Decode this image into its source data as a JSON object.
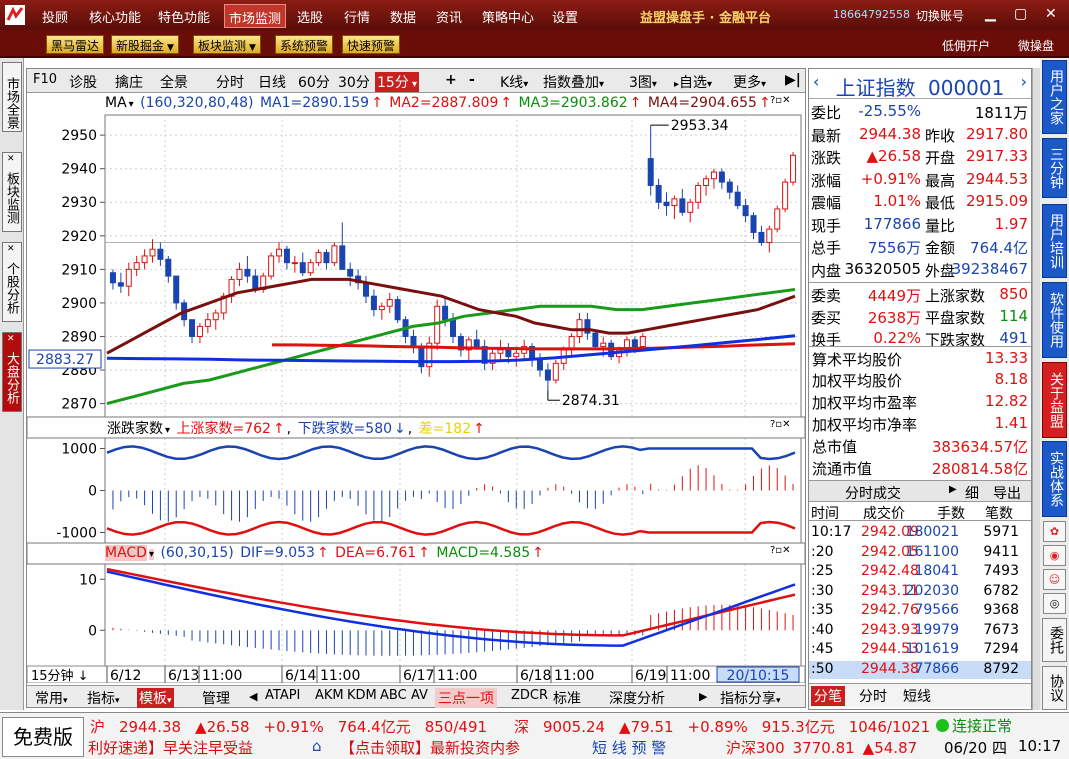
{
  "menubar": {
    "items": [
      "投顾",
      "核心功能",
      "特色功能",
      "市场监测",
      "选股",
      "行情",
      "数据",
      "资讯",
      "策略中心",
      "设置"
    ],
    "active_index": 3,
    "brand": "益盟操盘手 · 金融平台",
    "phone": "18664792558",
    "switch_account": "切换账号"
  },
  "toolbar": {
    "buttons": [
      "黑马雷达",
      "新股掘金",
      "板块监测",
      "系统预警",
      "快速预警"
    ],
    "right": [
      "低佣开户",
      "微操盘"
    ]
  },
  "left_tabs": [
    "市场全景",
    "板块监测",
    "个股分析",
    "大盘分析"
  ],
  "chart_toolbar": {
    "items": [
      "F10",
      "诊股",
      "擒庄",
      "全景",
      "分时",
      "日线",
      "60分",
      "30分",
      "15分",
      "+",
      "-",
      "K线",
      "指数叠加",
      "3图",
      "自选",
      "更多"
    ]
  },
  "ma_indicator": {
    "name": "MA",
    "params": "(160,320,80,48)",
    "ma1": "MA1=2890.159",
    "ma2": "MA2=2887.809",
    "ma3": "MA3=2903.862",
    "ma4": "MA4=2904.655"
  },
  "price_axis": {
    "ticks": [
      "2950",
      "2940",
      "2930",
      "2920",
      "2910",
      "2900",
      "2890",
      "2880",
      "2870"
    ],
    "cursor_price": "2883.27",
    "high_label": "2953.34",
    "low_label": "2874.31"
  },
  "breadth_indicator": {
    "name": "涨跌家数",
    "up": "上涨家数=762",
    "down": "下跌家数=580",
    "diff": "差=182",
    "ticks": [
      "1000",
      "0",
      "-1000"
    ]
  },
  "macd_indicator": {
    "name": "MACD",
    "params": "(60,30,15)",
    "dif": "DIF=9.053",
    "dea": "DEA=6.761",
    "macd": "MACD=4.585",
    "ticks": [
      "10",
      "0"
    ]
  },
  "time_axis": {
    "period": "15分钟",
    "labels": [
      "6/12",
      "6/13",
      "11:00",
      "6/14",
      "11:00",
      "6/17",
      "11:00",
      "6/18",
      "11:00",
      "6/19",
      "11:00"
    ],
    "cursor": "20/10:15"
  },
  "bottom_tabs": [
    "常用",
    "指标",
    "模板",
    "管理",
    "ATAPI",
    "AKM",
    "KDM",
    "ABC",
    "AV",
    "三点一项",
    "ZDCR",
    "标准",
    "深度分析",
    "指标分享"
  ],
  "quote": {
    "title": "上证指数",
    "code": "000001",
    "rows": [
      [
        "委比",
        "-25.55%",
        "",
        "1811万"
      ],
      [
        "最新",
        "2944.38",
        "昨收",
        "2917.80"
      ],
      [
        "涨跌",
        "▲26.58",
        "开盘",
        "2917.33"
      ],
      [
        "涨幅",
        "+0.91%",
        "最高",
        "2944.53"
      ],
      [
        "震幅",
        "1.01%",
        "最低",
        "2915.09"
      ],
      [
        "现手",
        "177866",
        "量比",
        "1.97"
      ],
      [
        "总手",
        "7556万",
        "金额",
        "764.4亿"
      ],
      [
        "内盘",
        "36320505",
        "外盘",
        "39238467"
      ],
      [
        "委卖",
        "4449万",
        "上涨家数",
        "850"
      ],
      [
        "委买",
        "2638万",
        "平盘家数",
        "114"
      ],
      [
        "换手",
        "0.22%",
        "下跌家数",
        "491"
      ]
    ],
    "stats": [
      [
        "算术平均股价",
        "13.33"
      ],
      [
        "加权平均股价",
        "8.18"
      ],
      [
        "加权平均市盈率",
        "12.82"
      ],
      [
        "加权平均市净率",
        "1.41"
      ],
      [
        "总市值",
        "383634.57亿"
      ],
      [
        "流通市值",
        "280814.58亿"
      ]
    ],
    "tick_header": [
      "分时成交",
      "细",
      "导出"
    ],
    "tick_cols": [
      "时间",
      "成交价",
      "手数",
      "笔数"
    ],
    "ticks": [
      [
        "10:17",
        "2942.09",
        "180021",
        "5971"
      ],
      [
        ":20",
        "2942.05",
        "161100",
        "9411"
      ],
      [
        ":25",
        "2942.48",
        "18041",
        "7493"
      ],
      [
        ":30",
        "2943.11",
        "202030",
        "6782"
      ],
      [
        ":35",
        "2942.76",
        "79566",
        "9368"
      ],
      [
        ":40",
        "2943.93",
        "19979",
        "7673"
      ],
      [
        ":45",
        "2944.53",
        "101619",
        "7294"
      ],
      [
        ":50",
        "2944.38",
        "77866",
        "8792"
      ]
    ],
    "bottom_tabs": [
      "分笔",
      "分时",
      "短线"
    ]
  },
  "right_tabs": [
    "用户之家",
    "三分钟",
    "用户培训",
    "软件使用",
    "关于益盟",
    "实战体系"
  ],
  "right_tabs2": [
    "委托",
    "协议"
  ],
  "status": {
    "free": "免费版",
    "sh": [
      "沪",
      "2944.38",
      "▲26.58",
      "+0.91%",
      "764.4亿元",
      "850/491"
    ],
    "sz": [
      "深",
      "9005.24",
      "▲79.51",
      "+0.89%",
      "915.3亿元",
      "1046/1021"
    ],
    "conn": "连接正常",
    "news": "利好速递】早关注早受益",
    "promo": "【点击领取】最新投资内参",
    "warn": "短 线 预 警",
    "hs300": [
      "沪深300",
      "3770.81",
      "▲54.87"
    ],
    "date": "06/20 四",
    "time": "10:17"
  },
  "chart_data": {
    "type": "candlestick",
    "ylim": [
      2866,
      2956
    ],
    "candles": [
      [
        2909,
        2910,
        2904,
        2906
      ],
      [
        2906,
        2909,
        2903,
        2905
      ],
      [
        2905,
        2912,
        2902,
        2910
      ],
      [
        2910,
        2914,
        2908,
        2912
      ],
      [
        2912,
        2916,
        2910,
        2914
      ],
      [
        2914,
        2919,
        2912,
        2916
      ],
      [
        2916,
        2918,
        2911,
        2913
      ],
      [
        2913,
        2914,
        2906,
        2908
      ],
      [
        2908,
        2908,
        2898,
        2900
      ],
      [
        2900,
        2901,
        2893,
        2895
      ],
      [
        2895,
        2895,
        2888,
        2890
      ],
      [
        2890,
        2894,
        2888,
        2893
      ],
      [
        2893,
        2897,
        2891,
        2895
      ],
      [
        2895,
        2898,
        2892,
        2897
      ],
      [
        2897,
        2903,
        2895,
        2902
      ],
      [
        2902,
        2908,
        2900,
        2907
      ],
      [
        2907,
        2912,
        2905,
        2910
      ],
      [
        2910,
        2914,
        2906,
        2908
      ],
      [
        2908,
        2910,
        2903,
        2904
      ],
      [
        2904,
        2909,
        2903,
        2908
      ],
      [
        2908,
        2915,
        2907,
        2914
      ],
      [
        2914,
        2918,
        2912,
        2916
      ],
      [
        2916,
        2917,
        2910,
        2912
      ],
      [
        2912,
        2914,
        2909,
        2912
      ],
      [
        2912,
        2915,
        2908,
        2909
      ],
      [
        2909,
        2913,
        2908,
        2912
      ],
      [
        2912,
        2916,
        2911,
        2915
      ],
      [
        2915,
        2916,
        2910,
        2912
      ],
      [
        2912,
        2918,
        2911,
        2917
      ],
      [
        2917,
        2924,
        2914,
        2910
      ],
      [
        2910,
        2912,
        2905,
        2908
      ],
      [
        2908,
        2910,
        2904,
        2906
      ],
      [
        2906,
        2908,
        2900,
        2902
      ],
      [
        2902,
        2904,
        2896,
        2898
      ],
      [
        2898,
        2900,
        2895,
        2899
      ],
      [
        2899,
        2903,
        2897,
        2901
      ],
      [
        2901,
        2902,
        2894,
        2895
      ],
      [
        2895,
        2896,
        2888,
        2890
      ],
      [
        2890,
        2892,
        2885,
        2887
      ],
      [
        2887,
        2888,
        2879,
        2881
      ],
      [
        2881,
        2890,
        2878,
        2888
      ],
      [
        2888,
        2901,
        2886,
        2899
      ],
      [
        2899,
        2902,
        2893,
        2895
      ],
      [
        2895,
        2897,
        2888,
        2890
      ],
      [
        2890,
        2891,
        2884,
        2886
      ],
      [
        2886,
        2890,
        2883,
        2889
      ],
      [
        2889,
        2892,
        2886,
        2887
      ],
      [
        2887,
        2889,
        2880,
        2882
      ],
      [
        2882,
        2886,
        2880,
        2885
      ],
      [
        2885,
        2889,
        2883,
        2886
      ],
      [
        2886,
        2888,
        2882,
        2884
      ],
      [
        2884,
        2887,
        2881,
        2885
      ],
      [
        2885,
        2889,
        2883,
        2887
      ],
      [
        2887,
        2888,
        2881,
        2883
      ],
      [
        2883,
        2885,
        2878,
        2880
      ],
      [
        2880,
        2882,
        2874,
        2877
      ],
      [
        2877,
        2883,
        2876,
        2882
      ],
      [
        2882,
        2887,
        2880,
        2886
      ],
      [
        2886,
        2891,
        2884,
        2890
      ],
      [
        2890,
        2897,
        2888,
        2895
      ],
      [
        2895,
        2897,
        2889,
        2891
      ],
      [
        2891,
        2892,
        2886,
        2887
      ],
      [
        2887,
        2890,
        2884,
        2888
      ],
      [
        2888,
        2889,
        2883,
        2884
      ],
      [
        2884,
        2887,
        2882,
        2886
      ],
      [
        2886,
        2890,
        2884,
        2889
      ],
      [
        2889,
        2890,
        2885,
        2887
      ],
      [
        2887,
        2891,
        2886,
        2890
      ],
      [
        2943,
        2953,
        2932,
        2935
      ],
      [
        2935,
        2937,
        2928,
        2930
      ],
      [
        2930,
        2933,
        2926,
        2929
      ],
      [
        2929,
        2932,
        2925,
        2931
      ],
      [
        2931,
        2934,
        2926,
        2927
      ],
      [
        2927,
        2931,
        2924,
        2930
      ],
      [
        2930,
        2936,
        2928,
        2935
      ],
      [
        2935,
        2938,
        2932,
        2937
      ],
      [
        2937,
        2940,
        2934,
        2939
      ],
      [
        2939,
        2940,
        2934,
        2936
      ],
      [
        2936,
        2937,
        2931,
        2933
      ],
      [
        2933,
        2935,
        2928,
        2929
      ],
      [
        2929,
        2931,
        2924,
        2926
      ],
      [
        2926,
        2927,
        2919,
        2921
      ],
      [
        2921,
        2923,
        2917,
        2918
      ],
      [
        2918,
        2923,
        2915,
        2922
      ],
      [
        2922,
        2929,
        2921,
        2928
      ],
      [
        2928,
        2937,
        2927,
        2936
      ],
      [
        2936,
        2945,
        2935,
        2944
      ]
    ],
    "ma1": [
      2885,
      2888,
      2891,
      2894,
      2897,
      2899,
      2901,
      2903,
      2904,
      2905,
      2906,
      2907,
      2907,
      2907,
      2906,
      2905,
      2904,
      2903,
      2902,
      2900,
      2898,
      2897,
      2896,
      2894,
      2893,
      2892,
      2892,
      2891,
      2891,
      2892,
      2893,
      2894,
      2895,
      2896,
      2897,
      2898,
      2900,
      2902
    ],
    "ma2": [
      2887.5,
      2887.5,
      2887.4,
      2887.3,
      2887.2,
      2887,
      2886.9,
      2886.8,
      2886.6,
      2886.5,
      2886.4,
      2886.3,
      2886.3,
      2886.3,
      2886.3,
      2886.4,
      2886.5,
      2886.7,
      2886.9,
      2887.1,
      2887.4,
      2887.6,
      2887.8
    ],
    "ma3": [
      2870,
      2872,
      2874,
      2876,
      2877,
      2879,
      2881,
      2883,
      2885,
      2887,
      2889,
      2891,
      2893,
      2894,
      2896,
      2897,
      2898,
      2899,
      2899,
      2899,
      2898,
      2898,
      2899,
      2900,
      2901,
      2902,
      2903,
      2904
    ],
    "ma4": [
      2883.5,
      2883.4,
      2883.3,
      2883.2,
      2883,
      2882.9,
      2882.8,
      2882.7,
      2882.6,
      2882.5,
      2882.5,
      2882.6,
      2883,
      2883.6,
      2884.5,
      2885.4,
      2886.3,
      2887.2,
      2888.2,
      2889.2,
      2890.2
    ]
  }
}
